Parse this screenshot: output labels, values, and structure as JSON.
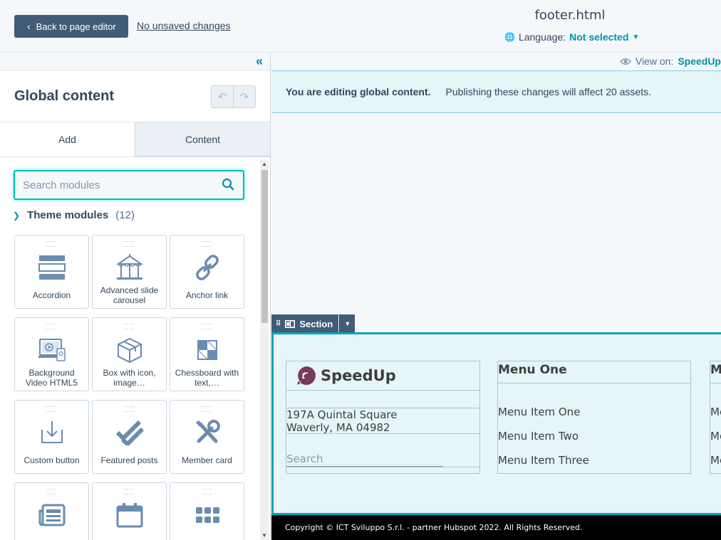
{
  "topbar": {
    "back_label": "Back to page editor",
    "unsaved_label": "No unsaved changes",
    "filename": "footer.html",
    "language_label": "Language:",
    "language_value": "Not selected"
  },
  "sidebar": {
    "title": "Global content",
    "tabs": [
      {
        "label": "Add",
        "active": true
      },
      {
        "label": "Content",
        "active": false
      }
    ],
    "search_placeholder": "Search modules",
    "section": {
      "label": "Theme modules",
      "count": "(12)"
    },
    "modules": [
      {
        "label": "Accordion",
        "icon": "accordion-icon"
      },
      {
        "label": "Advanced slide carousel",
        "icon": "carousel-icon"
      },
      {
        "label": "Anchor link",
        "icon": "link-icon"
      },
      {
        "label": "Background Video HTML5",
        "icon": "video-icon"
      },
      {
        "label": "Box with icon, image…",
        "icon": "box-icon"
      },
      {
        "label": "Chessboard with text,…",
        "icon": "chessboard-icon"
      },
      {
        "label": "Custom button",
        "icon": "button-icon"
      },
      {
        "label": "Featured posts",
        "icon": "checkmarks-icon"
      },
      {
        "label": "Member card",
        "icon": "tools-icon"
      },
      {
        "label": "",
        "icon": "news-icon"
      },
      {
        "label": "",
        "icon": "calendar-icon"
      },
      {
        "label": "",
        "icon": "grid-icon"
      }
    ]
  },
  "main": {
    "view_on_label": "View on:",
    "view_on_value": "SpeedUp",
    "banner_strong": "You are editing global content.",
    "banner_note": "Publishing these changes will affect 20 assets.",
    "section_chip_label": "Section",
    "footer": {
      "logo_text": "SpeedUp",
      "address_line1": "197A Quintal Square",
      "address_line2": "Waverly, MA 04982",
      "search_placeholder": "Search",
      "menu_title": "Menu One",
      "menu_items": [
        "Menu Item One",
        "Menu Item Two",
        "Menu Item Three"
      ],
      "menu2_title_partial": "M",
      "menu2_items_partial": [
        "Me",
        "Me",
        "Me"
      ],
      "copyright": "Copyright © ICT Sviluppo S.r.l. - partner Hubspot 2022. All Rights Reserved."
    }
  },
  "colors": {
    "accent": "#0091ae",
    "dark_button": "#425b76",
    "focus_border": "#00bda5",
    "banner_bg": "#e5f5f8",
    "footer_border": "#00a4bd"
  }
}
